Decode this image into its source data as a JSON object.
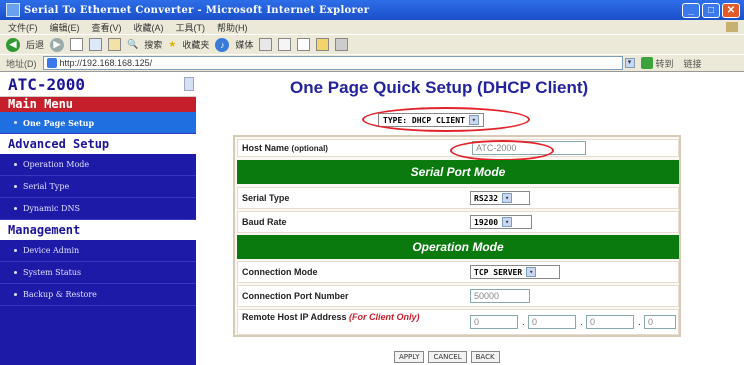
{
  "window": {
    "title": "Serial To Ethernet Converter - Microsoft Internet Explorer"
  },
  "menubar": {
    "items": [
      "文件(F)",
      "编辑(E)",
      "查看(V)",
      "收藏(A)",
      "工具(T)",
      "帮助(H)"
    ]
  },
  "toolbar": {
    "back": "后退",
    "search": "搜索",
    "favorites": "收藏夹",
    "media": "媒体"
  },
  "address": {
    "label": "地址(D)",
    "url": "http://192.168.168.125/",
    "go": "转到",
    "links": "链接"
  },
  "sidebar": {
    "logo": "ATC-2000",
    "main_menu": "Main Menu",
    "main_items": [
      "One Page Setup"
    ],
    "advanced_title": "Advanced Setup",
    "advanced_items": [
      "Operation Mode",
      "Serial Type",
      "Dynamic DNS"
    ],
    "management_title": "Management",
    "management_items": [
      "Device Admin",
      "System Status",
      "Backup & Restore"
    ]
  },
  "main": {
    "title": "One Page Quick Setup (DHCP Client)",
    "type_select": "TYPE: DHCP CLIENT",
    "host_name": {
      "label": "Host Name",
      "note": "(optional)",
      "value": "ATC-2000"
    },
    "serial_section": "Serial Port Mode",
    "serial_type": {
      "label": "Serial Type",
      "value": "RS232"
    },
    "baud_rate": {
      "label": "Baud Rate",
      "value": "19200"
    },
    "operation_section": "Operation Mode",
    "connection_mode": {
      "label": "Connection Mode",
      "value": "TCP SERVER"
    },
    "port": {
      "label": "Connection Port Number",
      "value": "50000"
    },
    "remote_ip": {
      "label": "Remote Host IP Address",
      "note": "(For Client Only)",
      "octets": [
        "0",
        "0",
        "0",
        "0"
      ]
    },
    "buttons": {
      "apply": "APPLY",
      "cancel": "CANCEL",
      "back": "BACK"
    }
  },
  "colors": {
    "sidebar": "#1e1aa8",
    "section_green": "#0a7a0f",
    "title_blue": "#24239d",
    "highlight_red": "#e2232a"
  }
}
